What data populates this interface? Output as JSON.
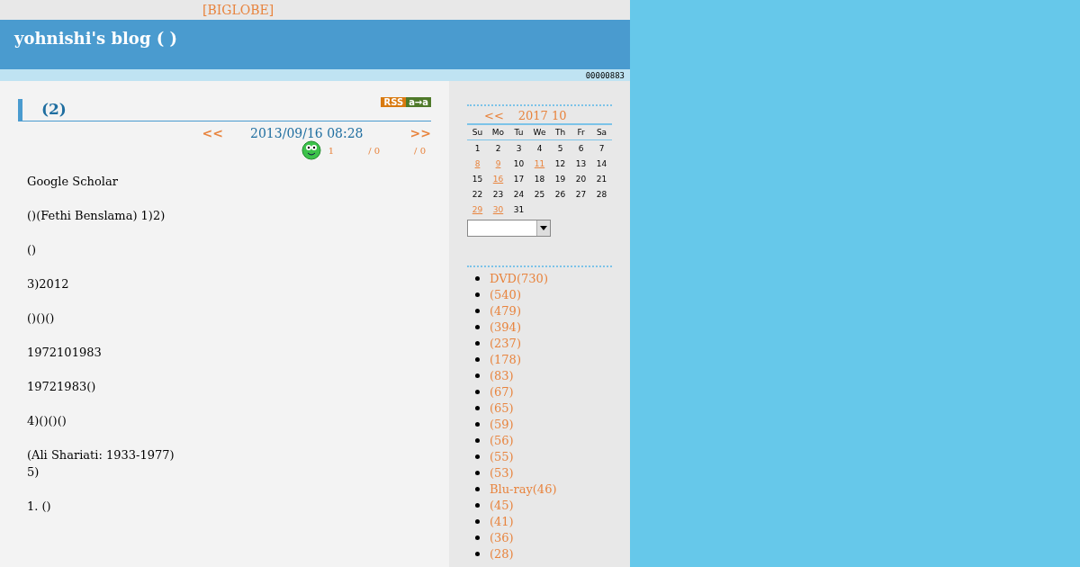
{
  "top_bar": {
    "link": "[BIGLOBE]"
  },
  "header": {
    "title": "yohnishi's blog ( )"
  },
  "counter": "00000883",
  "entry": {
    "title": "(2)",
    "rss": "RSS",
    "rss_extra": "a→a",
    "prev": "<<",
    "date": "2013/09/16 08:28",
    "next": ">>",
    "stats": [
      "1",
      "/ 0",
      "/ 0"
    ],
    "sections": [
      [
        [
          "Google Scholar"
        ],
        [
          "()(Fethi Benslama) 1)2)"
        ],
        [
          "()"
        ],
        [
          "3)2012"
        ],
        [
          "()()()"
        ]
      ],
      [
        [
          "1972101983"
        ],
        [
          "19721983()"
        ],
        [
          "4)()()()"
        ]
      ],
      [
        [
          "(Ali Shariati: 1933-1977)",
          "5)"
        ],
        [
          "1. ()"
        ]
      ]
    ]
  },
  "calendar": {
    "prev": "<<",
    "title": "2017 10",
    "weekdays": [
      "Su",
      "Mo",
      "Tu",
      "We",
      "Th",
      "Fr",
      "Sa"
    ],
    "weeks": [
      [
        {
          "day": "1",
          "link": false
        },
        {
          "day": "2",
          "link": false
        },
        {
          "day": "3",
          "link": false
        },
        {
          "day": "4",
          "link": false
        },
        {
          "day": "5",
          "link": false
        },
        {
          "day": "6",
          "link": false
        },
        {
          "day": "7",
          "link": false
        }
      ],
      [
        {
          "day": "8",
          "link": true
        },
        {
          "day": "9",
          "link": true
        },
        {
          "day": "10",
          "link": false
        },
        {
          "day": "11",
          "link": true
        },
        {
          "day": "12",
          "link": false
        },
        {
          "day": "13",
          "link": false
        },
        {
          "day": "14",
          "link": false
        }
      ],
      [
        {
          "day": "15",
          "link": false
        },
        {
          "day": "16",
          "link": true
        },
        {
          "day": "17",
          "link": false
        },
        {
          "day": "18",
          "link": false
        },
        {
          "day": "19",
          "link": false
        },
        {
          "day": "20",
          "link": false
        },
        {
          "day": "21",
          "link": false
        }
      ],
      [
        {
          "day": "22",
          "link": false
        },
        {
          "day": "23",
          "link": false
        },
        {
          "day": "24",
          "link": false
        },
        {
          "day": "25",
          "link": false
        },
        {
          "day": "26",
          "link": false
        },
        {
          "day": "27",
          "link": false
        },
        {
          "day": "28",
          "link": false
        }
      ],
      [
        {
          "day": "29",
          "link": true
        },
        {
          "day": "30",
          "link": true
        },
        {
          "day": "31",
          "link": false
        }
      ]
    ]
  },
  "categories": [
    "DVD(730)",
    "(540)",
    "(479)",
    "(394)",
    "(237)",
    "(178)",
    "(83)",
    "(67)",
    "(65)",
    "(59)",
    "(56)",
    "(55)",
    "(53)",
    "Blu-ray(46)",
    "(45)",
    "(41)",
    "(36)",
    "(28)"
  ]
}
